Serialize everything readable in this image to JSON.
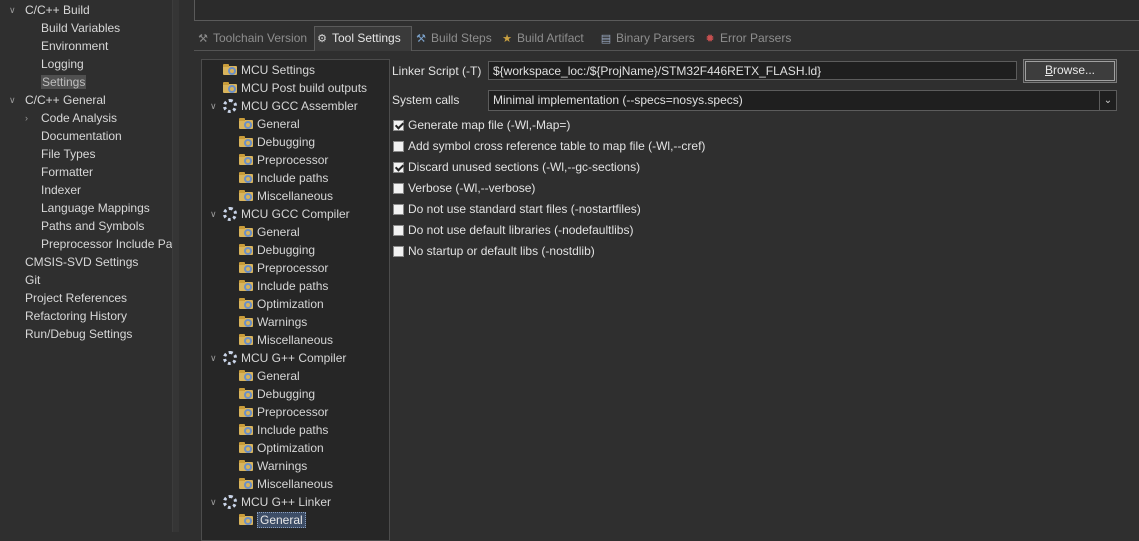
{
  "nav": {
    "items": [
      {
        "label": "C/C++ Build",
        "level": 0,
        "expanded": true
      },
      {
        "label": "Build Variables",
        "level": 1
      },
      {
        "label": "Environment",
        "level": 1
      },
      {
        "label": "Logging",
        "level": 1
      },
      {
        "label": "Settings",
        "level": 1,
        "selected": true
      },
      {
        "label": "C/C++ General",
        "level": 0,
        "expanded": true
      },
      {
        "label": "Code Analysis",
        "level": 1,
        "collapsed": true
      },
      {
        "label": "Documentation",
        "level": 1
      },
      {
        "label": "File Types",
        "level": 1
      },
      {
        "label": "Formatter",
        "level": 1
      },
      {
        "label": "Indexer",
        "level": 1
      },
      {
        "label": "Language Mappings",
        "level": 1
      },
      {
        "label": "Paths and Symbols",
        "level": 1
      },
      {
        "label": "Preprocessor Include Pat",
        "level": 1
      },
      {
        "label": "CMSIS-SVD Settings",
        "level": 0
      },
      {
        "label": "Git",
        "level": 0
      },
      {
        "label": "Project References",
        "level": 0
      },
      {
        "label": "Refactoring History",
        "level": 0
      },
      {
        "label": "Run/Debug Settings",
        "level": 0
      }
    ]
  },
  "tabs": [
    {
      "label": "Toolchain Version",
      "icon": "wrench-icon",
      "active": false
    },
    {
      "label": "Tool Settings",
      "icon": "gear-icon",
      "active": true
    },
    {
      "label": "Build Steps",
      "icon": "hammer-icon",
      "active": false
    },
    {
      "label": "Build Artifact",
      "icon": "trophy-icon",
      "active": false
    },
    {
      "label": "Binary Parsers",
      "icon": "document-icon",
      "active": false
    },
    {
      "label": "Error Parsers",
      "icon": "bug-icon",
      "active": false
    }
  ],
  "tooltree": {
    "items": [
      {
        "label": "MCU Settings",
        "type": "folder",
        "level": 0
      },
      {
        "label": "MCU Post build outputs",
        "type": "folder",
        "level": 0
      },
      {
        "label": "MCU GCC Assembler",
        "type": "tool",
        "level": 0,
        "expanded": true
      },
      {
        "label": "General",
        "type": "folder",
        "level": 1
      },
      {
        "label": "Debugging",
        "type": "folder",
        "level": 1
      },
      {
        "label": "Preprocessor",
        "type": "folder",
        "level": 1
      },
      {
        "label": "Include paths",
        "type": "folder",
        "level": 1
      },
      {
        "label": "Miscellaneous",
        "type": "folder",
        "level": 1
      },
      {
        "label": "MCU GCC Compiler",
        "type": "tool",
        "level": 0,
        "expanded": true
      },
      {
        "label": "General",
        "type": "folder",
        "level": 1
      },
      {
        "label": "Debugging",
        "type": "folder",
        "level": 1
      },
      {
        "label": "Preprocessor",
        "type": "folder",
        "level": 1
      },
      {
        "label": "Include paths",
        "type": "folder",
        "level": 1
      },
      {
        "label": "Optimization",
        "type": "folder",
        "level": 1
      },
      {
        "label": "Warnings",
        "type": "folder",
        "level": 1
      },
      {
        "label": "Miscellaneous",
        "type": "folder",
        "level": 1
      },
      {
        "label": "MCU G++ Compiler",
        "type": "tool",
        "level": 0,
        "expanded": true
      },
      {
        "label": "General",
        "type": "folder",
        "level": 1
      },
      {
        "label": "Debugging",
        "type": "folder",
        "level": 1
      },
      {
        "label": "Preprocessor",
        "type": "folder",
        "level": 1
      },
      {
        "label": "Include paths",
        "type": "folder",
        "level": 1
      },
      {
        "label": "Optimization",
        "type": "folder",
        "level": 1
      },
      {
        "label": "Warnings",
        "type": "folder",
        "level": 1
      },
      {
        "label": "Miscellaneous",
        "type": "folder",
        "level": 1
      },
      {
        "label": "MCU G++ Linker",
        "type": "tool",
        "level": 0,
        "expanded": true
      },
      {
        "label": "General",
        "type": "folder",
        "level": 1,
        "selected": true
      }
    ]
  },
  "linker": {
    "script_label": "Linker Script (-T)",
    "script_value": "${workspace_loc:/${ProjName}/STM32F446RETX_FLASH.ld}",
    "browse_label": "Browse...",
    "browse_mnemonic": "B",
    "browse_rest": "rowse...",
    "syscalls_label": "System calls",
    "syscalls_value": "Minimal implementation (--specs=nosys.specs)",
    "options": [
      {
        "label": "Generate map file (-Wl,-Map=)",
        "checked": true
      },
      {
        "label": "Add symbol cross reference table to map file (-Wl,--cref)",
        "checked": false
      },
      {
        "label": "Discard unused sections (-Wl,--gc-sections)",
        "checked": true
      },
      {
        "label": "Verbose (-Wl,--verbose)",
        "checked": false
      },
      {
        "label": "Do not use standard start files (-nostartfiles)",
        "checked": false
      },
      {
        "label": "Do not use default libraries (-nodefaultlibs)",
        "checked": false
      },
      {
        "label": "No startup or default libs (-nostdlib)",
        "checked": false
      }
    ]
  }
}
